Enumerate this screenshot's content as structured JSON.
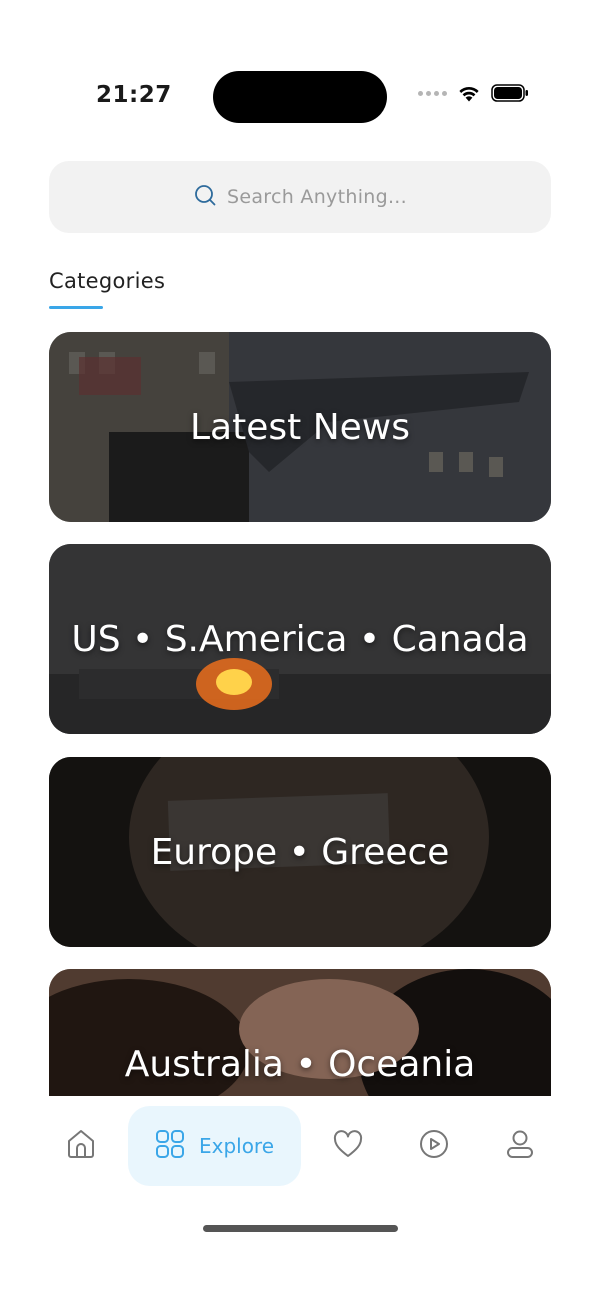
{
  "status_bar": {
    "time": "21:27"
  },
  "search": {
    "placeholder": "Search Anything...",
    "icon": "search-icon"
  },
  "categories": {
    "title": "Categories",
    "items": [
      {
        "label": "Latest News"
      },
      {
        "label": "US • S.America • Canada"
      },
      {
        "label": "Europe • Greece"
      },
      {
        "label": "Australia • Oceania"
      }
    ]
  },
  "nav": {
    "items": [
      {
        "icon": "home-icon",
        "label": ""
      },
      {
        "icon": "grid-icon",
        "label": "Explore",
        "active": true
      },
      {
        "icon": "heart-icon",
        "label": ""
      },
      {
        "icon": "play-icon",
        "label": ""
      },
      {
        "icon": "profile-icon",
        "label": ""
      }
    ]
  },
  "colors": {
    "accent": "#3aa6e8",
    "search_bg": "#f2f2f2",
    "active_nav_bg": "#e9f6fd"
  }
}
